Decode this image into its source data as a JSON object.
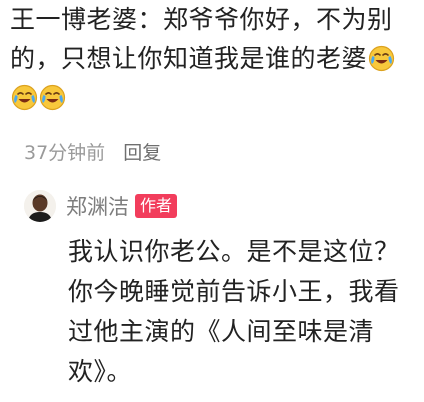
{
  "comment": {
    "text": "王一博老婆：郑爷爷你好，不为别的，只想让你知道我是谁的老婆",
    "emojis": [
      "laughing-crying-emoji",
      "laughing-crying-emoji",
      "laughing-crying-emoji"
    ],
    "time": "37分钟前",
    "reply_label": "回复"
  },
  "reply": {
    "author": "郑渊洁",
    "badge": "作者",
    "text": "我认识你老公。是不是这位？你今晚睡觉前告诉小王，我看过他主演的《人间至味是清欢》。"
  },
  "colors": {
    "badge": "#f23d5c",
    "text": "#222222",
    "meta": "#9a9a9a"
  }
}
